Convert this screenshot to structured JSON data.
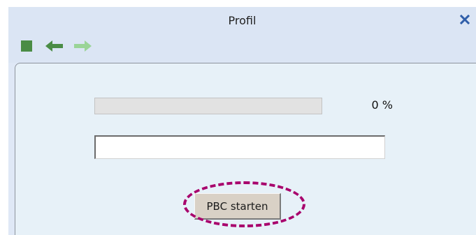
{
  "window": {
    "title": "Profil",
    "close_icon": "close-icon"
  },
  "toolbar": {
    "stop_icon": "stop-icon",
    "back_icon": "arrow-left-icon",
    "forward_icon": "arrow-right-icon"
  },
  "progress": {
    "value": 0,
    "label": "0 %"
  },
  "status": {
    "value": ""
  },
  "pbc": {
    "label": "PBC starten"
  },
  "colors": {
    "title_bar": "#dbe5f4",
    "panel": "#e7f1f8",
    "icon_green": "#4a8c45",
    "icon_light_green": "#9ad497",
    "close_blue": "#2f5ea9",
    "highlight": "#a8006c"
  }
}
